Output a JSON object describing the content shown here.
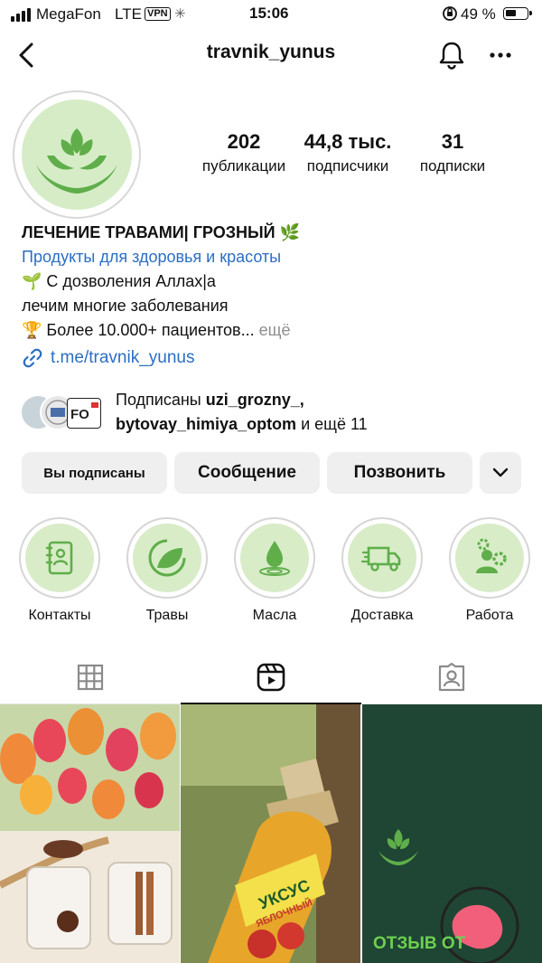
{
  "status_bar": {
    "carrier": "MegaFon",
    "network": "LTE",
    "vpn": "VPN",
    "time": "15:06",
    "battery_percent": "49 %",
    "battery_level": 0.49
  },
  "header": {
    "username": "travnik_yunus",
    "icons": [
      "back-icon",
      "bell-icon",
      "more-icon"
    ]
  },
  "profile": {
    "stats": [
      {
        "value": "202",
        "label": "публикации"
      },
      {
        "value": "44,8 тыс.",
        "label": "подписчики"
      },
      {
        "value": "31",
        "label": "подписки"
      }
    ],
    "bio": {
      "title": "ЛЕЧЕНИЕ ТРАВАМИ| ГРОЗНЫЙ 🌿",
      "category": "Продукты для здоровья и красоты",
      "line1": "🌱 С дозволения Аллах|а",
      "line2": "лечим многие заболевания",
      "line3": "🏆 Более 10.000+ пациентов...",
      "more": " ещё"
    },
    "link": "t.me/travnik_yunus",
    "followed_by": {
      "prefix": "Подписаны ",
      "users": "uzi_grozny_,",
      "users2": "bytovay_himiya_optom",
      "suffix": " и ещё 11"
    }
  },
  "actions": {
    "subscribed": "Вы подписаны",
    "message": "Сообщение",
    "call": "Позвонить"
  },
  "highlights": [
    {
      "label": "Контакты",
      "icon": "contacts-icon"
    },
    {
      "label": "Травы",
      "icon": "leaf-icon"
    },
    {
      "label": "Масла",
      "icon": "oil-drop-icon"
    },
    {
      "label": "Доставка",
      "icon": "truck-icon"
    },
    {
      "label": "Работа",
      "icon": "worker-gear-icon"
    }
  ],
  "tabs": [
    {
      "name": "grid",
      "icon": "grid-icon"
    },
    {
      "name": "reels",
      "icon": "reels-icon",
      "active": true
    },
    {
      "name": "tagged",
      "icon": "tagged-icon"
    }
  ],
  "posts": [
    {
      "description_icon": "tea-photo"
    },
    {
      "label": "УКСУС",
      "label2": "ЯБЛОЧНЫЙ"
    },
    {
      "label": "ОТЗЫВ ОТ"
    }
  ],
  "colors": {
    "brand_green": "#5fae4a",
    "link_blue": "#2a6ec4",
    "highlight_bg": "#d8ecc8"
  }
}
